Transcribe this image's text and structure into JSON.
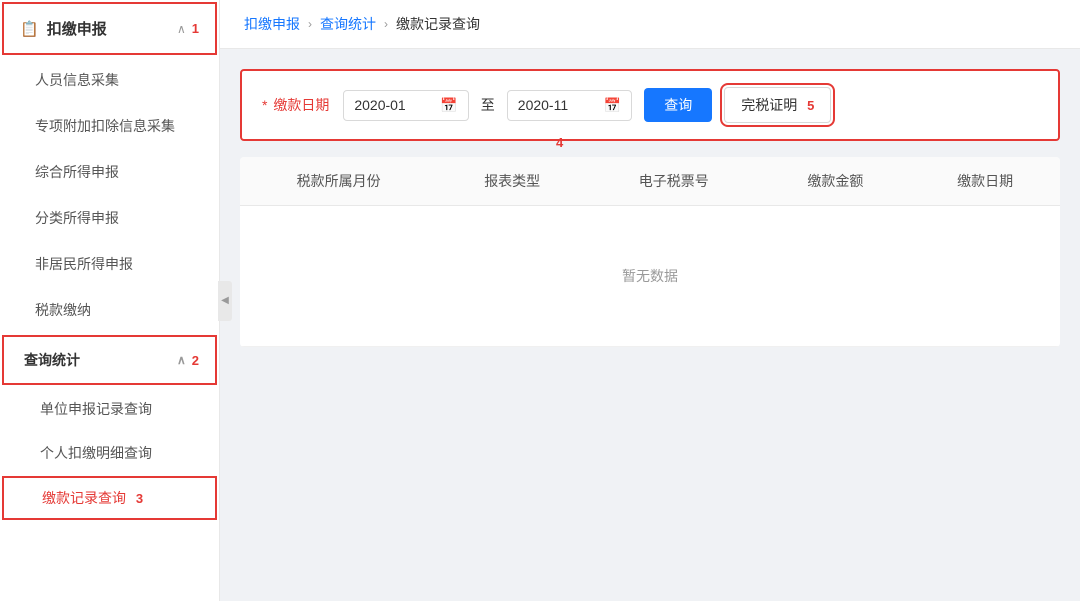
{
  "sidebar": {
    "main_section_label": "扣缴申报",
    "main_section_icon": "📋",
    "menu_items": [
      {
        "label": "人员信息采集",
        "id": "personnel-info"
      },
      {
        "label": "专项附加扣除信息采集",
        "id": "special-deduction"
      },
      {
        "label": "综合所得申报",
        "id": "comprehensive-income"
      },
      {
        "label": "分类所得申报",
        "id": "classified-income"
      },
      {
        "label": "非居民所得申报",
        "id": "non-resident"
      },
      {
        "label": "税款缴纳",
        "id": "tax-payment"
      }
    ],
    "query_section": {
      "label": "查询统计",
      "sub_items": [
        {
          "label": "单位申报记录查询",
          "id": "unit-record"
        },
        {
          "label": "个人扣缴明细查询",
          "id": "personal-detail"
        },
        {
          "label": "缴款记录查询",
          "id": "payment-record",
          "active": true
        }
      ]
    }
  },
  "breadcrumb": {
    "items": [
      {
        "label": "扣缴申报",
        "link": true
      },
      {
        "label": "查询统计",
        "link": true
      },
      {
        "label": "缴款记录查询",
        "link": false
      }
    ]
  },
  "filter": {
    "date_label": "缴款日期",
    "date_from": "2020-01",
    "date_from_placeholder": "2020-01",
    "date_to": "2020-11",
    "date_to_placeholder": "2020-11",
    "to_label": "至",
    "query_btn_label": "查询",
    "cert_btn_label": "完税证明"
  },
  "table": {
    "columns": [
      "税款所属月份",
      "报表类型",
      "电子税票号",
      "缴款金额",
      "缴款日期"
    ],
    "empty_text": "暂无数据"
  },
  "labels": {
    "badge_1": "1",
    "badge_2": "2",
    "badge_3": "3",
    "badge_4": "4",
    "badge_5": "5",
    "collapse_arrow": "◀"
  }
}
